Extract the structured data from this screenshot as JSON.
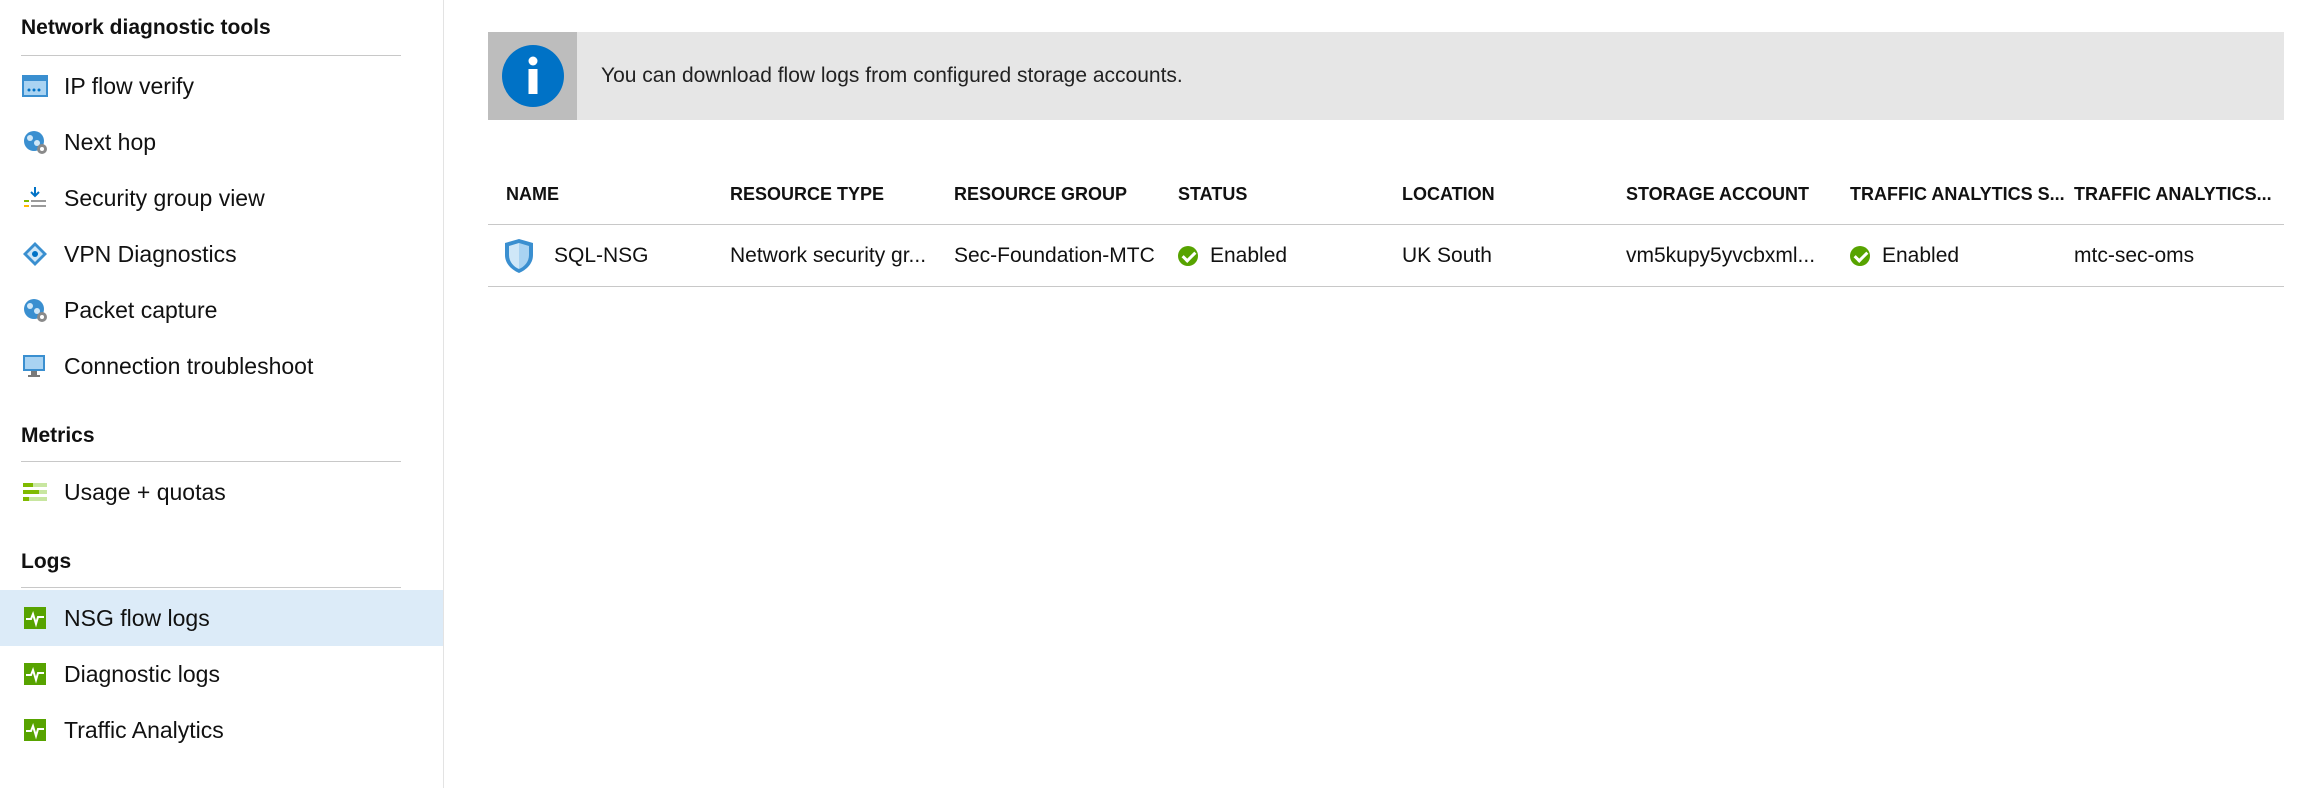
{
  "sidebar": {
    "sections": [
      {
        "title": "Network diagnostic tools",
        "items": [
          {
            "label": "IP flow verify",
            "icon": "ip-flow-verify-icon"
          },
          {
            "label": "Next hop",
            "icon": "next-hop-icon"
          },
          {
            "label": "Security group view",
            "icon": "security-group-view-icon"
          },
          {
            "label": "VPN Diagnostics",
            "icon": "vpn-diagnostics-icon"
          },
          {
            "label": "Packet capture",
            "icon": "packet-capture-icon"
          },
          {
            "label": "Connection troubleshoot",
            "icon": "connection-troubleshoot-icon"
          }
        ]
      },
      {
        "title": "Metrics",
        "items": [
          {
            "label": "Usage + quotas",
            "icon": "usage-quotas-icon"
          }
        ]
      },
      {
        "title": "Logs",
        "items": [
          {
            "label": "NSG flow logs",
            "icon": "nsg-flow-logs-icon",
            "selected": true
          },
          {
            "label": "Diagnostic logs",
            "icon": "diagnostic-logs-icon"
          },
          {
            "label": "Traffic Analytics",
            "icon": "traffic-analytics-icon"
          }
        ]
      }
    ]
  },
  "banner": {
    "text": "You can download flow logs from configured storage accounts.",
    "icon": "info-icon"
  },
  "table": {
    "columns": [
      "NAME",
      "RESOURCE TYPE",
      "RESOURCE GROUP",
      "STATUS",
      "LOCATION",
      "STORAGE ACCOUNT",
      "TRAFFIC ANALYTICS S...",
      "TRAFFIC ANALYTICS..."
    ],
    "rows": [
      {
        "name": "SQL-NSG",
        "resource_type": "Network security gr...",
        "resource_group": "Sec-Foundation-MTC",
        "status": "Enabled",
        "location": "UK South",
        "storage_account": "vm5kupy5yvcbxml...",
        "traffic_analytics_status": "Enabled",
        "traffic_analytics_workspace": "mtc-sec-oms"
      }
    ]
  },
  "colors": {
    "selected_bg": "#dcebf8",
    "info_blue": "#0072c6",
    "status_green": "#57a300",
    "banner_bg": "#e6e6e6"
  }
}
